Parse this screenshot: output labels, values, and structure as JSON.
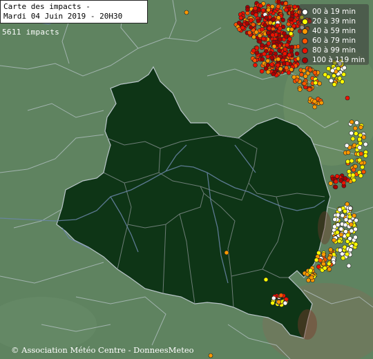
{
  "title": {
    "line1": "Carte des impacts -",
    "line2": "Mardi 04 Juin 2019 - 20H30"
  },
  "impact_count": "5611 impacts",
  "legend": [
    {
      "label": "00 à 19 min",
      "color": "#ffffff"
    },
    {
      "label": "20 à 39 min",
      "color": "#ffff00"
    },
    {
      "label": "40 à 59 min",
      "color": "#ff9900"
    },
    {
      "label": "60 à 79 min",
      "color": "#ff5500"
    },
    {
      "label": "80 à 99 min",
      "color": "#ee1100"
    },
    {
      "label": "100 à 119 min",
      "color": "#aa0000"
    }
  ],
  "credit": "© Association Météo Centre - DonneesMeteo",
  "colors": {
    "terrain": "#5f8360",
    "region_fill": "#0e3516",
    "borders": "#b8c4c8",
    "rivers": "#6a86a8"
  }
}
